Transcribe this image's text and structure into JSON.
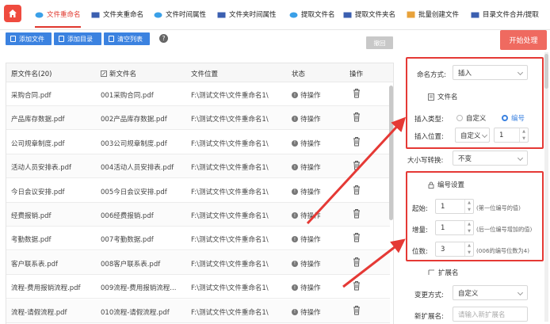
{
  "tabs": [
    {
      "label": "文件重命名",
      "active": true
    },
    {
      "label": "文件夹重命名"
    },
    {
      "label": "文件时间属性"
    },
    {
      "label": "文件夹时间属性"
    },
    {
      "label": "提取文件名"
    },
    {
      "label": "提取文件夹名"
    },
    {
      "label": "批量创建文件"
    },
    {
      "label": "目录文件合并/提取"
    }
  ],
  "toolbar": {
    "add_file": "添加文件",
    "add_dir": "添加目录",
    "clear": "清空列表",
    "help": "?",
    "undo": "撤回",
    "start": "开始处理"
  },
  "table": {
    "headers": {
      "original": "原文件名(20)",
      "new": "新文件名",
      "location": "文件位置",
      "status": "状态",
      "action": "操作"
    },
    "rows": [
      {
        "original": "采购合同.pdf",
        "new": "001采购合同.pdf",
        "location": "F:\\测试文件\\文件重命名1\\",
        "status": "待操作"
      },
      {
        "original": "产品库存数据.pdf",
        "new": "002产品库存数据.pdf",
        "location": "F:\\测试文件\\文件重命名1\\",
        "status": "待操作"
      },
      {
        "original": "公司规章制度.pdf",
        "new": "003公司规章制度.pdf",
        "location": "F:\\测试文件\\文件重命名1\\",
        "status": "待操作"
      },
      {
        "original": "活动人员安排表.pdf",
        "new": "004活动人员安排表.pdf",
        "location": "F:\\测试文件\\文件重命名1\\",
        "status": "待操作"
      },
      {
        "original": "今日会议安排.pdf",
        "new": "005今日会议安排.pdf",
        "location": "F:\\测试文件\\文件重命名1\\",
        "status": "待操作"
      },
      {
        "original": "经费报销.pdf",
        "new": "006经费报销.pdf",
        "location": "F:\\测试文件\\文件重命名1\\",
        "status": "待操作"
      },
      {
        "original": "考勤数据.pdf",
        "new": "007考勤数据.pdf",
        "location": "F:\\测试文件\\文件重命名1\\",
        "status": "待操作"
      },
      {
        "original": "客户联系表.pdf",
        "new": "008客户联系表.pdf",
        "location": "F:\\测试文件\\文件重命名1\\",
        "status": "待操作"
      },
      {
        "original": "流程-费用报销流程.pdf",
        "new": "009流程-费用报销流程...",
        "location": "F:\\测试文件\\文件重命名1\\",
        "status": "待操作"
      },
      {
        "original": "流程-请假流程.pdf",
        "new": "010流程-请假流程.pdf",
        "location": "F:\\测试文件\\文件重命名1\\",
        "status": "待操作"
      }
    ]
  },
  "panel": {
    "naming_mode_label": "命名方式:",
    "naming_mode_value": "插入",
    "filename_section": "文件名",
    "insert_type_label": "插入类型:",
    "insert_type_opt1": "自定义",
    "insert_type_opt2": "编号",
    "insert_pos_label": "插入位置:",
    "insert_pos_value": "自定义",
    "insert_pos_num": "1",
    "case_label": "大小写转换:",
    "case_value": "不变",
    "numbering_section": "编号设置",
    "start_label": "起始:",
    "start_value": "1",
    "start_hint": "(第一位编号的值)",
    "increment_label": "增量:",
    "increment_value": "1",
    "increment_hint": "(后一位编号增加的值)",
    "digits_label": "位数:",
    "digits_value": "3",
    "digits_hint": "(006的编号位数为4)",
    "ext_section": "扩展名",
    "ext_mode_label": "变更方式:",
    "ext_mode_value": "自定义",
    "new_ext_label": "新扩展名:",
    "new_ext_placeholder": "请输入新扩展名"
  },
  "colors": {
    "accent": "#e0382e",
    "blue": "#3b82e0",
    "red_box": "#e53935"
  }
}
